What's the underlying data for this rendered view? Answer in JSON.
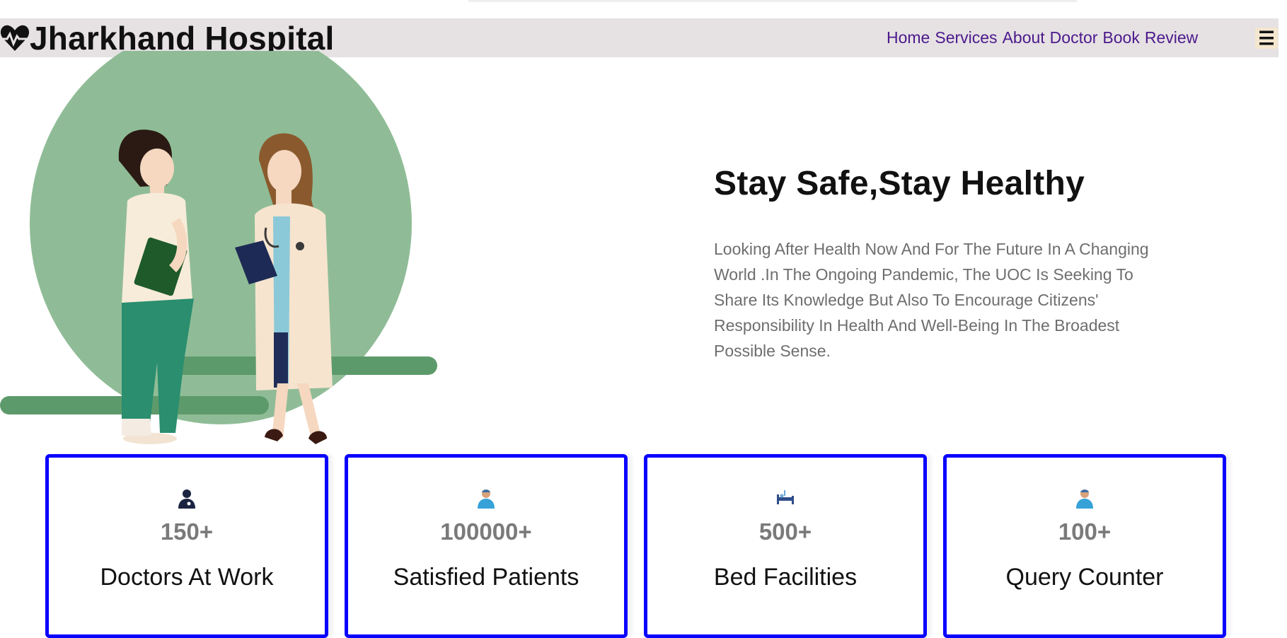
{
  "brand": {
    "name": "Jharkhand Hospital",
    "icon": "heartbeat-icon"
  },
  "nav": {
    "links": [
      "Home",
      "Services",
      "About",
      "Doctor",
      "Book",
      "Review"
    ],
    "menu_icon": "☰"
  },
  "hero": {
    "title": "Stay Safe,Stay Healthy",
    "text": "Looking After Health Now And For The Future In A Changing World .In The Ongoing Pandemic, The UOC Is Seeking To Share Its Knowledge But Also To Encourage Citizens' Responsibility In Health And Well-Being In The Broadest Possible Sense."
  },
  "stats": [
    {
      "icon": "doctor-icon",
      "value": "150+",
      "label": "Doctors At Work"
    },
    {
      "icon": "patient-icon",
      "value": "100000+",
      "label": "Satisfied Patients"
    },
    {
      "icon": "hospital-bed-icon",
      "value": "500+",
      "label": "Bed Facilities"
    },
    {
      "icon": "patient-icon",
      "value": "100+",
      "label": "Query Counter"
    }
  ],
  "colors": {
    "header_bg": "#e6e1e3",
    "nav_link": "#4b1a8c",
    "card_border": "#0a00ff",
    "hero_circle": "#8fbc96"
  }
}
